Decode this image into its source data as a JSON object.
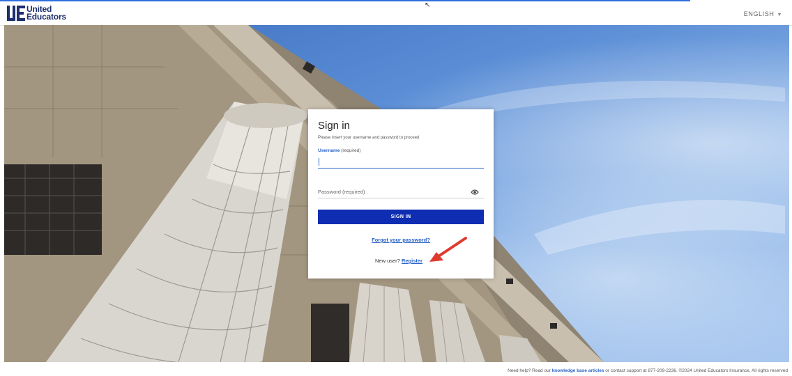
{
  "header": {
    "logo_line1": "United",
    "logo_line2": "Educators",
    "language": "ENGLISH"
  },
  "login": {
    "title": "Sign in",
    "subtitle": "Please insert your username and password to proceed",
    "username_label": "Username",
    "username_required": "(required)",
    "username_value": "",
    "password_placeholder": "Password (required)",
    "password_value": "",
    "signin_label": "SIGN IN",
    "forgot_label": "Forgot your password?",
    "new_user_text": "New user?",
    "register_label": "Register"
  },
  "footer": {
    "text_before": "Need help? Read our",
    "kb_link": "knowledge base articles",
    "text_after": "or contact support at 877-209-2236. ©2024 United Educators Insurance, All rights reserved"
  },
  "colors": {
    "brand_navy": "#1d2f6f",
    "button_blue": "#0e2db3",
    "link_blue": "#2a62c7",
    "annotation_red": "#e03a2f"
  },
  "icons": [
    "logo-mark-icon",
    "chevron-down-icon",
    "eye-icon",
    "annotation-arrow-icon",
    "mouse-cursor-icon"
  ]
}
